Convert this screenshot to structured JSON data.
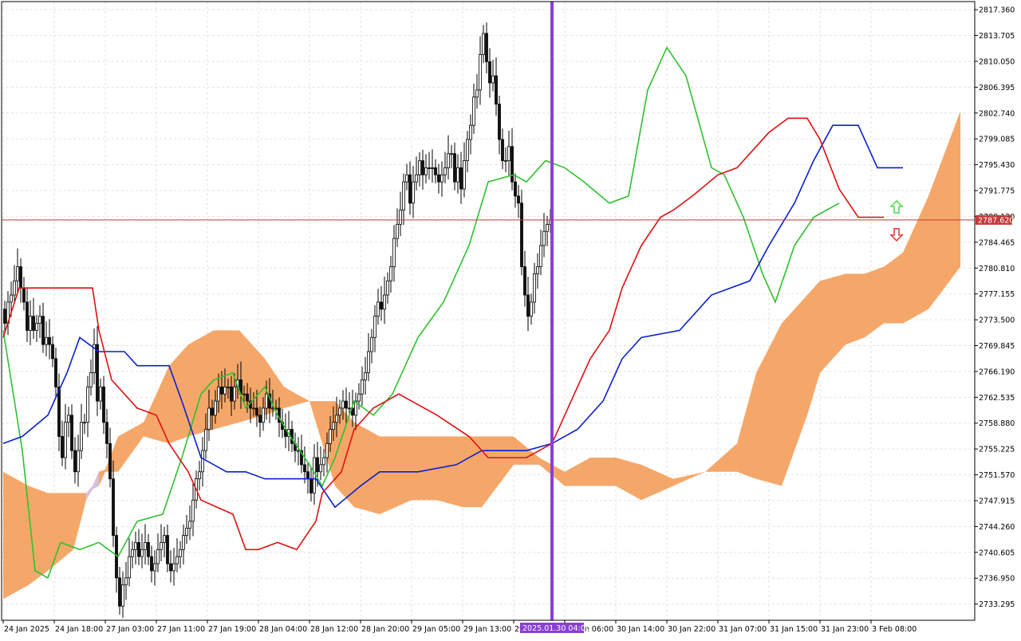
{
  "chart_data": {
    "type": "candlestick",
    "y_axis": {
      "ticks": [
        2817.36,
        2813.705,
        2810.05,
        2806.395,
        2802.74,
        2799.085,
        2795.43,
        2791.775,
        2788.12,
        2784.465,
        2780.81,
        2777.155,
        2773.5,
        2769.845,
        2766.19,
        2762.535,
        2758.88,
        2755.225,
        2751.57,
        2747.915,
        2744.26,
        2740.605,
        2736.95,
        2733.295
      ],
      "tick_labels": [
        "2817.360",
        "2813.705",
        "2810.050",
        "2806.395",
        "2802.740",
        "2799.085",
        "2795.430",
        "2791.775",
        "2788.120",
        "2784.465",
        "2780.810",
        "2777.155",
        "2773.500",
        "2769.845",
        "2766.190",
        "2762.535",
        "2758.880",
        "2755.225",
        "2751.570",
        "2747.915",
        "2744.260",
        "2740.605",
        "2736.950",
        "2733.295"
      ],
      "range": [
        2731.0,
        2818.5
      ]
    },
    "x_axis": {
      "labels": [
        {
          "bar": 0,
          "text": "24 Jan 2025"
        },
        {
          "bar": 16,
          "text": "24 Jan 18:00"
        },
        {
          "bar": 32,
          "text": "27 Jan 03:00"
        },
        {
          "bar": 48,
          "text": "27 Jan 11:00"
        },
        {
          "bar": 64,
          "text": "27 Jan 19:00"
        },
        {
          "bar": 80,
          "text": "28 Jan 04:00"
        },
        {
          "bar": 96,
          "text": "28 Jan 12:00"
        },
        {
          "bar": 112,
          "text": "28 Jan 20:00"
        },
        {
          "bar": 128,
          "text": "29 Jan 05:00"
        },
        {
          "bar": 144,
          "text": "29 Jan 13:00"
        },
        {
          "bar": 160,
          "text": "29"
        },
        {
          "bar": 176,
          "text": "30 Jan 06:00"
        },
        {
          "bar": 192,
          "text": "30 Jan 14:00"
        },
        {
          "bar": 208,
          "text": "30 Jan 22:00"
        },
        {
          "bar": 224,
          "text": "31 Jan 07:00"
        },
        {
          "bar": 240,
          "text": "31 Jan 15:00"
        },
        {
          "bar": 256,
          "text": "31 Jan 23:00"
        },
        {
          "bar": 272,
          "text": "3 Feb 08:00"
        }
      ],
      "marker_label": "2025.01.30 04:00",
      "marker_bar": 172
    },
    "current_price": {
      "value": 2787.62,
      "label": "2787.620"
    },
    "signals": {
      "up_arrow_bar": 277,
      "up_arrow_price": 2789.3,
      "down_arrow_bar": 277,
      "down_arrow_price": 2785.7
    },
    "candles_o": [
      2775.0,
      2773.0,
      2776.0,
      2777.0,
      2779.0,
      2781.0,
      2778.0,
      2776.0,
      2772.0,
      2774.0,
      2772.0,
      2773.0,
      2774.0,
      2770.0,
      2771.0,
      2770.0,
      2768.0,
      2764.0,
      2757.0,
      2754.0,
      2759.0,
      2760.0,
      2755.0,
      2752.0,
      2755.0,
      2759.0,
      2759.0,
      2764.0,
      2766.0,
      2770.0,
      2762.0,
      2764.0,
      2759.0,
      2756.0,
      2751.0,
      2743.0,
      2737.0,
      2733.0,
      2736.0,
      2737.0,
      2740.0,
      2741.0,
      2742.0,
      2740.0,
      2741.0,
      2742.0,
      2740.0,
      2738.0,
      2739.0,
      2741.0,
      2742.0,
      2743.0,
      2739.0,
      2738.0,
      2739.0,
      2740.0,
      2741.0,
      2743.0,
      2744.0,
      2745.0,
      2748.0,
      2751.0,
      2752.0,
      2755.0,
      2758.0,
      2761.0,
      2760.0,
      2762.0,
      2764.0,
      2763.0,
      2764.0,
      2764.0,
      2762.0,
      2764.0,
      2765.0,
      2763.0,
      2763.0,
      2762.0,
      2761.0,
      2761.0,
      2760.0,
      2759.0,
      2761.0,
      2763.0,
      2761.0,
      2761.0,
      2761.0,
      2759.0,
      2758.0,
      2757.0,
      2758.0,
      2756.0,
      2755.0,
      2755.0,
      2753.0,
      2752.0,
      2751.0,
      2749.0,
      2754.0,
      2752.0,
      2753.0,
      2754.0,
      2756.0,
      2758.0,
      2759.0,
      2760.0,
      2761.0,
      2762.0,
      2761.0,
      2761.0,
      2760.0,
      2762.0,
      2763.0,
      2765.0,
      2766.0,
      2769.0,
      2771.0,
      2774.0,
      2776.0,
      2775.0,
      2777.0,
      2779.0,
      2781.0,
      2785.0,
      2787.0,
      2789.0,
      2793.0,
      2794.0,
      2790.0,
      2793.0,
      2794.0,
      2796.0,
      2794.0,
      2795.0,
      2795.0,
      2795.0,
      2794.0,
      2793.0,
      2794.0,
      2795.0,
      2797.0,
      2797.0,
      2793.0,
      2795.0,
      2792.0,
      2796.0,
      2799.0,
      2801.0,
      2805.0,
      2806.0,
      2811.0,
      2814.0,
      2810.0,
      2807.0,
      2808.0,
      2804.0,
      2799.0,
      2796.0,
      2796.0,
      2798.0,
      2793.0,
      2791.0,
      2790.0,
      2781.0,
      2777.0,
      2774.0,
      2776.0,
      2780.0,
      2781.0,
      2784.0,
      2786.0,
      2787.0
    ],
    "candles_c": [
      2773.0,
      2776.0,
      2777.0,
      2779.0,
      2781.0,
      2778.0,
      2776.0,
      2772.0,
      2774.0,
      2772.0,
      2773.0,
      2774.0,
      2770.0,
      2771.0,
      2770.0,
      2768.0,
      2764.0,
      2757.0,
      2754.0,
      2759.0,
      2760.0,
      2755.0,
      2752.0,
      2755.0,
      2759.0,
      2759.0,
      2764.0,
      2766.0,
      2770.0,
      2762.0,
      2764.0,
      2759.0,
      2756.0,
      2751.0,
      2743.0,
      2737.0,
      2733.0,
      2736.0,
      2737.0,
      2740.0,
      2741.0,
      2742.0,
      2740.0,
      2741.0,
      2742.0,
      2740.0,
      2738.0,
      2739.0,
      2741.0,
      2742.0,
      2743.0,
      2739.0,
      2738.0,
      2739.0,
      2740.0,
      2741.0,
      2743.0,
      2744.0,
      2745.0,
      2748.0,
      2751.0,
      2752.0,
      2755.0,
      2758.0,
      2761.0,
      2760.0,
      2762.0,
      2764.0,
      2763.0,
      2764.0,
      2764.0,
      2762.0,
      2764.0,
      2765.0,
      2763.0,
      2763.0,
      2762.0,
      2761.0,
      2761.0,
      2760.0,
      2759.0,
      2761.0,
      2763.0,
      2761.0,
      2761.0,
      2761.0,
      2759.0,
      2758.0,
      2757.0,
      2758.0,
      2756.0,
      2755.0,
      2755.0,
      2753.0,
      2752.0,
      2751.0,
      2749.0,
      2754.0,
      2752.0,
      2753.0,
      2754.0,
      2756.0,
      2758.0,
      2759.0,
      2760.0,
      2761.0,
      2762.0,
      2761.0,
      2761.0,
      2760.0,
      2762.0,
      2763.0,
      2765.0,
      2766.0,
      2769.0,
      2771.0,
      2774.0,
      2776.0,
      2775.0,
      2777.0,
      2779.0,
      2781.0,
      2785.0,
      2787.0,
      2789.0,
      2793.0,
      2794.0,
      2790.0,
      2793.0,
      2794.0,
      2796.0,
      2794.0,
      2795.0,
      2795.0,
      2795.0,
      2794.0,
      2793.0,
      2794.0,
      2795.0,
      2797.0,
      2797.0,
      2793.0,
      2795.0,
      2792.0,
      2796.0,
      2799.0,
      2801.0,
      2805.0,
      2806.0,
      2811.0,
      2814.0,
      2810.0,
      2807.0,
      2808.0,
      2804.0,
      2799.0,
      2796.0,
      2796.0,
      2798.0,
      2793.0,
      2791.0,
      2790.0,
      2781.0,
      2777.0,
      2774.0,
      2776.0,
      2780.0,
      2781.0,
      2784.0,
      2786.0,
      2787.0,
      2787.6
    ],
    "tenkan": [
      [
        0,
        2771
      ],
      [
        5,
        2778
      ],
      [
        12,
        2778
      ],
      [
        28,
        2778
      ],
      [
        30,
        2772
      ],
      [
        34,
        2765
      ],
      [
        42,
        2761
      ],
      [
        48,
        2760
      ],
      [
        52,
        2756
      ],
      [
        58,
        2752
      ],
      [
        62,
        2748
      ],
      [
        72,
        2746
      ],
      [
        76,
        2741
      ],
      [
        80,
        2741
      ],
      [
        86,
        2742
      ],
      [
        92,
        2741
      ],
      [
        98,
        2745
      ],
      [
        100,
        2749
      ],
      [
        106,
        2752
      ],
      [
        110,
        2758
      ],
      [
        116,
        2761
      ],
      [
        124,
        2763
      ],
      [
        128,
        2762
      ],
      [
        136,
        2760
      ],
      [
        146,
        2757
      ],
      [
        152,
        2754
      ],
      [
        164,
        2754
      ],
      [
        172,
        2756
      ],
      [
        176,
        2760
      ],
      [
        180,
        2764
      ],
      [
        184,
        2768
      ],
      [
        190,
        2772
      ],
      [
        194,
        2778
      ],
      [
        200,
        2784
      ],
      [
        206,
        2788
      ],
      [
        210,
        2789
      ],
      [
        216,
        2791
      ],
      [
        224,
        2794
      ],
      [
        230,
        2795
      ],
      [
        236,
        2798
      ],
      [
        240,
        2800
      ],
      [
        246,
        2802
      ],
      [
        252,
        2802
      ],
      [
        256,
        2799
      ],
      [
        262,
        2792
      ],
      [
        268,
        2788
      ],
      [
        276,
        2788
      ]
    ],
    "kijun": [
      [
        0,
        2756
      ],
      [
        6,
        2757
      ],
      [
        14,
        2760
      ],
      [
        20,
        2766
      ],
      [
        24,
        2771
      ],
      [
        30,
        2769
      ],
      [
        38,
        2769
      ],
      [
        42,
        2767
      ],
      [
        52,
        2767
      ],
      [
        56,
        2762
      ],
      [
        62,
        2754
      ],
      [
        70,
        2752
      ],
      [
        76,
        2752
      ],
      [
        82,
        2751
      ],
      [
        90,
        2751
      ],
      [
        98,
        2751
      ],
      [
        104,
        2747
      ],
      [
        112,
        2750
      ],
      [
        118,
        2752
      ],
      [
        130,
        2752
      ],
      [
        142,
        2753
      ],
      [
        150,
        2755
      ],
      [
        164,
        2755
      ],
      [
        172,
        2756
      ],
      [
        180,
        2758
      ],
      [
        188,
        2762
      ],
      [
        194,
        2768
      ],
      [
        200,
        2771
      ],
      [
        212,
        2772
      ],
      [
        222,
        2777
      ],
      [
        234,
        2779
      ],
      [
        240,
        2784
      ],
      [
        248,
        2790
      ],
      [
        254,
        2796
      ],
      [
        260,
        2801
      ],
      [
        268,
        2801
      ],
      [
        274,
        2795
      ],
      [
        282,
        2795
      ]
    ],
    "chikou": [
      [
        0,
        2772
      ],
      [
        6,
        2755
      ],
      [
        10,
        2738
      ],
      [
        14,
        2737
      ],
      [
        18,
        2742
      ],
      [
        24,
        2741
      ],
      [
        30,
        2742
      ],
      [
        36,
        2740
      ],
      [
        42,
        2745
      ],
      [
        50,
        2746
      ],
      [
        56,
        2754
      ],
      [
        62,
        2763
      ],
      [
        66,
        2765
      ],
      [
        72,
        2766
      ],
      [
        76,
        2761
      ],
      [
        82,
        2764
      ],
      [
        86,
        2760
      ],
      [
        90,
        2757
      ],
      [
        96,
        2753
      ],
      [
        100,
        2750
      ],
      [
        104,
        2754
      ],
      [
        110,
        2762
      ],
      [
        116,
        2760
      ],
      [
        122,
        2763
      ],
      [
        130,
        2771
      ],
      [
        138,
        2776
      ],
      [
        146,
        2784
      ],
      [
        152,
        2793
      ],
      [
        160,
        2794
      ],
      [
        164,
        2793
      ],
      [
        170,
        2796
      ],
      [
        176,
        2795
      ],
      [
        182,
        2793
      ],
      [
        190,
        2790
      ],
      [
        196,
        2791
      ],
      [
        202,
        2806
      ],
      [
        208,
        2812
      ],
      [
        214,
        2808
      ],
      [
        222,
        2795
      ],
      [
        226,
        2794
      ],
      [
        232,
        2788
      ],
      [
        238,
        2780
      ],
      [
        242,
        2776
      ],
      [
        248,
        2784
      ],
      [
        254,
        2788
      ],
      [
        262,
        2790
      ]
    ],
    "kumo_upper": [
      [
        0,
        2752
      ],
      [
        8,
        2750
      ],
      [
        14,
        2749
      ],
      [
        22,
        2749
      ],
      [
        26,
        2749
      ],
      [
        30,
        2750
      ],
      [
        36,
        2757
      ],
      [
        44,
        2759
      ],
      [
        52,
        2767
      ],
      [
        58,
        2770
      ],
      [
        66,
        2772
      ],
      [
        74,
        2772
      ],
      [
        82,
        2768
      ],
      [
        88,
        2764
      ],
      [
        96,
        2762
      ],
      [
        104,
        2762
      ],
      [
        110,
        2759
      ],
      [
        118,
        2757
      ],
      [
        128,
        2757
      ],
      [
        136,
        2757
      ],
      [
        144,
        2757
      ],
      [
        150,
        2757
      ],
      [
        160,
        2757
      ],
      [
        168,
        2754
      ],
      [
        176,
        2752
      ],
      [
        184,
        2754
      ],
      [
        192,
        2754
      ],
      [
        200,
        2753
      ],
      [
        210,
        2751
      ],
      [
        220,
        2752
      ],
      [
        230,
        2756
      ],
      [
        236,
        2766
      ],
      [
        244,
        2773
      ],
      [
        252,
        2777
      ],
      [
        256,
        2779
      ],
      [
        264,
        2780
      ],
      [
        270,
        2780
      ],
      [
        276,
        2781
      ],
      [
        282,
        2783
      ],
      [
        290,
        2791
      ],
      [
        300,
        2803
      ]
    ],
    "kumo_lower": [
      [
        0,
        2734
      ],
      [
        8,
        2736
      ],
      [
        14,
        2738
      ],
      [
        22,
        2741
      ],
      [
        26,
        2748
      ],
      [
        30,
        2752
      ],
      [
        36,
        2752
      ],
      [
        44,
        2757
      ],
      [
        52,
        2756
      ],
      [
        58,
        2757
      ],
      [
        66,
        2758
      ],
      [
        74,
        2759
      ],
      [
        82,
        2760
      ],
      [
        88,
        2761
      ],
      [
        96,
        2762
      ],
      [
        104,
        2750
      ],
      [
        110,
        2747
      ],
      [
        118,
        2746
      ],
      [
        128,
        2748
      ],
      [
        136,
        2748
      ],
      [
        144,
        2747
      ],
      [
        150,
        2747
      ],
      [
        160,
        2753
      ],
      [
        168,
        2753
      ],
      [
        176,
        2750
      ],
      [
        184,
        2750
      ],
      [
        192,
        2750
      ],
      [
        200,
        2748
      ],
      [
        210,
        2750
      ],
      [
        220,
        2752
      ],
      [
        230,
        2752
      ],
      [
        236,
        2751
      ],
      [
        244,
        2750
      ],
      [
        252,
        2760
      ],
      [
        256,
        2766
      ],
      [
        264,
        2770
      ],
      [
        270,
        2771
      ],
      [
        276,
        2773
      ],
      [
        282,
        2773
      ],
      [
        290,
        2775
      ],
      [
        300,
        2781
      ]
    ]
  }
}
